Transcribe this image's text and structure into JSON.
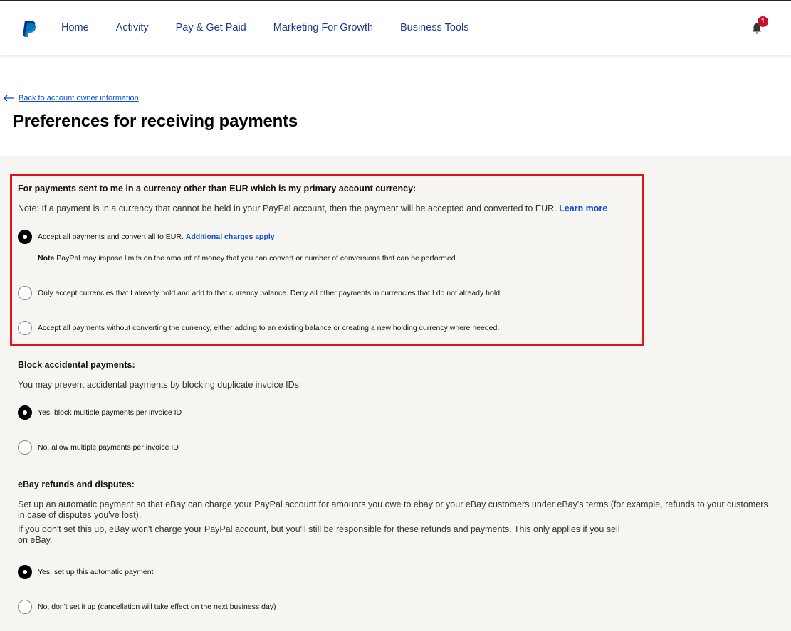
{
  "nav": {
    "items": [
      "Home",
      "Activity",
      "Pay & Get Paid",
      "Marketing For Growth",
      "Business Tools"
    ],
    "notification_count": "1"
  },
  "header": {
    "back_link": "Back to account owner information",
    "title": "Preferences for receiving payments"
  },
  "currency_section": {
    "heading": "For payments sent to me in a currency other than EUR which is my primary account currency:",
    "note": "Note: If a payment is in a currency that cannot be held in your PayPal account, then the payment will be accepted and converted to EUR.",
    "learn_more": "Learn more",
    "options": [
      {
        "label": "Accept all payments and convert all to EUR.",
        "extra": "Additional charges apply",
        "selected": true
      },
      {
        "label": "Only accept currencies that I already hold and add to that currency balance. Deny all other payments in currencies that I do not already hold.",
        "selected": false
      },
      {
        "label": "Accept all payments without converting the currency, either adding to an existing balance or creating a new holding currency where needed.",
        "selected": false
      }
    ],
    "option_note_prefix": "Note",
    "option_note": "PayPal may impose limits on the amount of money that you can convert or number of conversions that can be performed."
  },
  "block_section": {
    "heading": "Block accidental payments:",
    "description": "You may prevent accidental payments by blocking duplicate invoice IDs",
    "options": [
      {
        "label": "Yes, block multiple payments per invoice ID",
        "selected": true
      },
      {
        "label": "No, allow multiple payments per invoice ID",
        "selected": false
      }
    ]
  },
  "ebay_section": {
    "heading": "eBay refunds and disputes:",
    "description_1": "Set up an automatic payment so that eBay can charge your PayPal account for amounts you owe to ebay or your eBay customers under eBay's terms (for example, refunds to your customers in case of disputes you've lost).",
    "description_2": "If you don't set this up, eBay won't charge your PayPal account, but you'll still be responsible for these refunds and payments. This only applies if you sell on eBay.",
    "options": [
      {
        "label": "Yes, set up this automatic payment",
        "selected": true
      },
      {
        "label": "No, don't set it up (cancellation will take effect on the next business day)",
        "selected": false
      }
    ]
  },
  "colors": {
    "brand_blue": "#1c3a8c",
    "link_blue": "#0b4fcf",
    "highlight_red": "#e0151c",
    "panel_bg": "#f7f5f1"
  }
}
